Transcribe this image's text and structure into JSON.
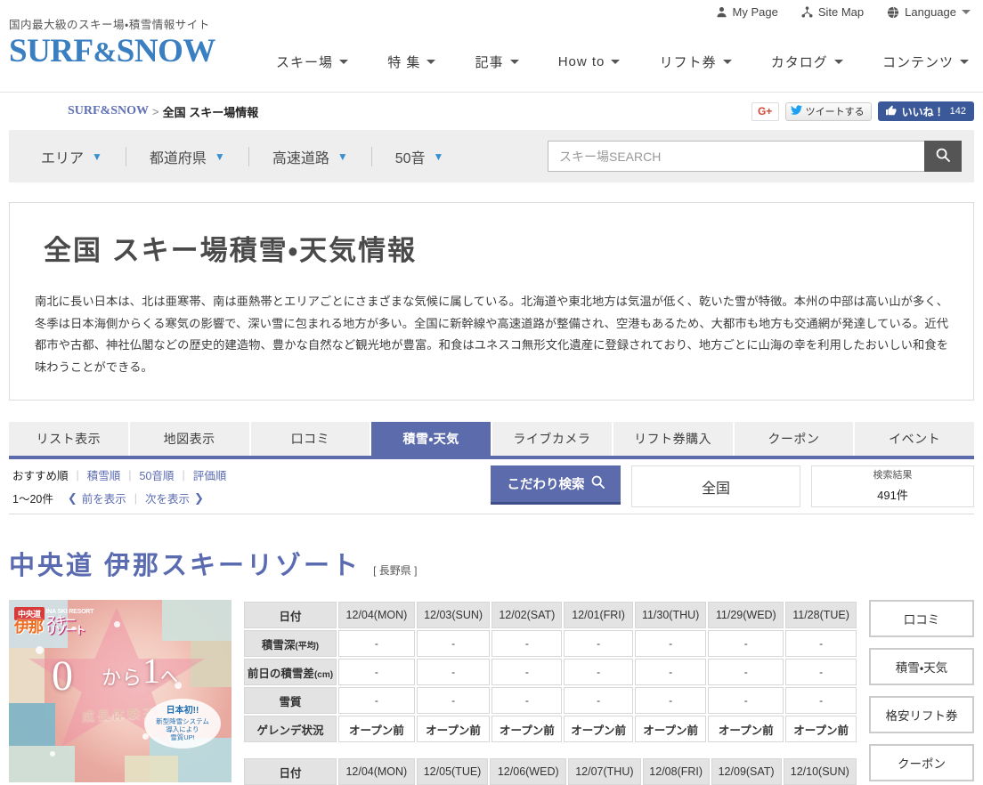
{
  "utility": {
    "items": [
      {
        "label": "My Page",
        "icon": "user-icon"
      },
      {
        "label": "Site Map",
        "icon": "sitemap-icon"
      },
      {
        "label": "Language",
        "icon": "globe-icon"
      }
    ]
  },
  "brand": {
    "tagline": "国内最大級のスキー場・積雪情報サイト",
    "logo_left": "SURF",
    "logo_amp": "&",
    "logo_right": "SNOW"
  },
  "mainnav": {
    "items": [
      {
        "label": "スキー場"
      },
      {
        "label": "特 集"
      },
      {
        "label": "記事"
      },
      {
        "label": "How to"
      },
      {
        "label": "リフト券"
      },
      {
        "label": "カタログ"
      },
      {
        "label": "コンテンツ"
      }
    ]
  },
  "breadcrumb": {
    "home": "SURF&SNOW",
    "separator": ">",
    "current": "全国 スキー場情報"
  },
  "social": {
    "gplus": "G+",
    "tweet": "ツイートする",
    "like": "いいね！",
    "like_count": "142"
  },
  "filterbar": {
    "items": [
      {
        "label": "エリア"
      },
      {
        "label": "都道府県"
      },
      {
        "label": "高速道路"
      },
      {
        "label": "50音"
      }
    ],
    "search_placeholder": "スキー場SEARCH",
    "search_value": ""
  },
  "intro": {
    "title": "全国 スキー場積雪・天気情報",
    "body": "南北に長い日本は、北は亜寒帯、南は亜熱帯とエリアごとにさまざまな気候に属している。北海道や東北地方は気温が低く、乾いた雪が特徴。本州の中部は高い山が多く、冬季は日本海側からくる寒気の影響で、深い雪に包まれる地方が多い。全国に新幹線や高速道路が整備され、空港もあるため、大都市も地方も交通網が発達している。近代都市や古都、神社仏閣などの歴史的建造物、豊かな自然など観光地が豊富。和食はユネスコ無形文化遺産に登録されており、地方ごとに山海の幸を利用したおいしい和食を味わうことができる。"
  },
  "tabs": [
    {
      "label": "リスト表示",
      "active": false
    },
    {
      "label": "地図表示",
      "active": false
    },
    {
      "label": "口コミ",
      "active": false
    },
    {
      "label": "積雪・天気",
      "active": true
    },
    {
      "label": "ライブカメラ",
      "active": false
    },
    {
      "label": "リフト券購入",
      "active": false
    },
    {
      "label": "クーポン",
      "active": false
    },
    {
      "label": "イベント",
      "active": false
    }
  ],
  "sortrow": {
    "sorts": [
      {
        "label": "おすすめ順",
        "active": true
      },
      {
        "label": "積雪順",
        "active": false
      },
      {
        "label": "50音順",
        "active": false
      },
      {
        "label": "評価順",
        "active": false
      }
    ],
    "range": "1〜20件",
    "prev": "前を表示",
    "next": "次を表示",
    "prev_arrow": "❮",
    "next_arrow": "❯",
    "kodawari": "こだわり検索",
    "area": "全国",
    "result_label": "検索結果",
    "result_count": "491",
    "result_unit": "件"
  },
  "resort": {
    "name": "中央道 伊那スキーリゾート",
    "prefecture": "[ 長野県 ]",
    "poster": {
      "badge": "中央道",
      "name_jp": "伊那",
      "name_ski": "スキー\nリゾート",
      "name_en": "INA SKI RESORT",
      "zero": "0",
      "kara": "から",
      "one": "1",
      "arrow": "へ",
      "catch": "成長体験王国",
      "seal_title": "日本初!!",
      "seal_line1": "新型降雪システム",
      "seal_line2": "導入により",
      "seal_line3": "雪質UP!"
    },
    "side_buttons": [
      {
        "label": "口コミ"
      },
      {
        "label": "積雪・天気"
      },
      {
        "label": "格安リフト券"
      },
      {
        "label": "クーポン"
      }
    ],
    "history_table": {
      "row_headers": [
        {
          "main": "日付",
          "sub": ""
        },
        {
          "main": "積雪深",
          "sub": "(平均)"
        },
        {
          "main": "前日の積雪差",
          "sub": "(cm)"
        },
        {
          "main": "雪質",
          "sub": ""
        },
        {
          "main": "ゲレンデ状況",
          "sub": ""
        }
      ],
      "dates": [
        "12/04(MON)",
        "12/03(SUN)",
        "12/02(SAT)",
        "12/01(FRI)",
        "11/30(THU)",
        "11/29(WED)",
        "11/28(TUE)"
      ],
      "snow_depth": [
        "-",
        "-",
        "-",
        "-",
        "-",
        "-",
        "-"
      ],
      "snow_diff": [
        "-",
        "-",
        "-",
        "-",
        "-",
        "-",
        "-"
      ],
      "snow_quality": [
        "-",
        "-",
        "-",
        "-",
        "-",
        "-",
        "-"
      ],
      "slope_status": [
        "オープン前",
        "オープン前",
        "オープン前",
        "オープン前",
        "オープン前",
        "オープン前",
        "オープン前"
      ]
    },
    "forecast_table": {
      "row_header": "日付",
      "dates": [
        "12/04(MON)",
        "12/05(TUE)",
        "12/06(WED)",
        "12/07(THU)",
        "12/08(FRI)",
        "12/09(SAT)",
        "12/10(SUN)"
      ]
    }
  },
  "colors": {
    "brand_blue": "#3a7fc1",
    "accent_indigo": "#5c6bab",
    "facebook": "#3b5998",
    "twitter": "#1da1f2",
    "gplus_red": "#d34836"
  }
}
